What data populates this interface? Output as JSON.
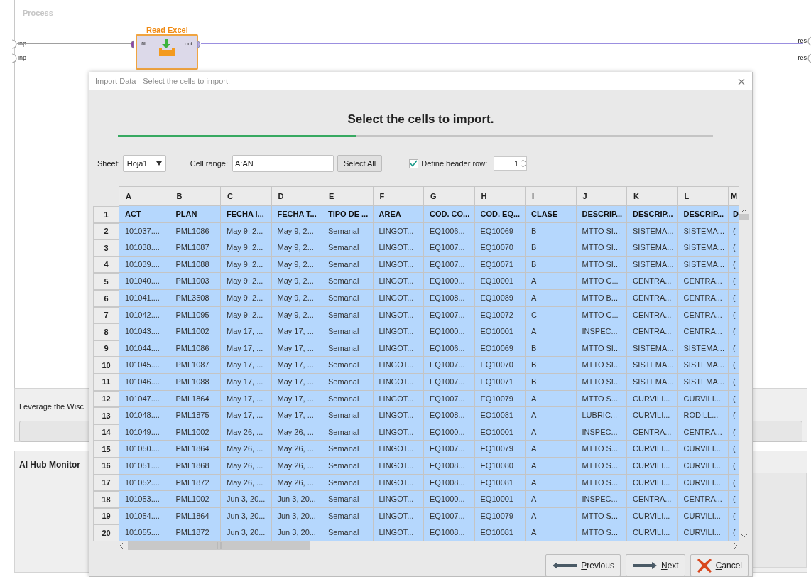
{
  "process": {
    "title": "Process",
    "input_ports": [
      "inp",
      "inp"
    ],
    "output_ports": [
      "res",
      "res"
    ],
    "operator": {
      "name": "Read Excel",
      "in_port": "fil",
      "out_port": "out"
    }
  },
  "panels": {
    "leverage_text": "Leverage the Wisc",
    "monitor_title": "AI Hub Monitor"
  },
  "dialog": {
    "title": "Import Data - Select the cells to import.",
    "heading": "Select the cells to import.",
    "progress": {
      "level": 0.4
    },
    "sheet": {
      "label": "Sheet:",
      "value": "Hoja1"
    },
    "cell_range": {
      "label": "Cell range:",
      "value": "A:AN"
    },
    "select_all": "Select All",
    "header_row": {
      "label": "Define header row:",
      "checked": true,
      "value": "1"
    },
    "table": {
      "columns": [
        "A",
        "B",
        "C",
        "D",
        "E",
        "F",
        "G",
        "H",
        "I",
        "J",
        "K",
        "L",
        "M"
      ],
      "rows": [
        {
          "number": "1",
          "header": true,
          "selected": true,
          "cells": [
            "ACT",
            "PLAN",
            "FECHA I...",
            "FECHA T...",
            "TIPO DE ...",
            "AREA",
            "COD. CO...",
            "COD. EQ...",
            "CLASE",
            "DESCRIP...",
            "DESCRIP...",
            "DESCRIP...",
            "D"
          ]
        },
        {
          "number": "2",
          "header": false,
          "selected": true,
          "cells": [
            "101037....",
            "PML1086",
            "May 9, 2...",
            "May 9, 2...",
            "Semanal",
            "LINGOT...",
            "EQ1006...",
            "EQ10069",
            "B",
            "MTTO SI...",
            "SISTEMA...",
            "SISTEMA...",
            "("
          ]
        },
        {
          "number": "3",
          "header": false,
          "selected": true,
          "cells": [
            "101038....",
            "PML1087",
            "May 9, 2...",
            "May 9, 2...",
            "Semanal",
            "LINGOT...",
            "EQ1007...",
            "EQ10070",
            "B",
            "MTTO SI...",
            "SISTEMA...",
            "SISTEMA...",
            "("
          ]
        },
        {
          "number": "4",
          "header": false,
          "selected": true,
          "cells": [
            "101039....",
            "PML1088",
            "May 9, 2...",
            "May 9, 2...",
            "Semanal",
            "LINGOT...",
            "EQ1007...",
            "EQ10071",
            "B",
            "MTTO SI...",
            "SISTEMA...",
            "SISTEMA...",
            "("
          ]
        },
        {
          "number": "5",
          "header": false,
          "selected": true,
          "cells": [
            "101040....",
            "PML1003",
            "May 9, 2...",
            "May 9, 2...",
            "Semanal",
            "LINGOT...",
            "EQ1000...",
            "EQ10001",
            "A",
            "MTTO C...",
            "CENTRA...",
            "CENTRA...",
            "("
          ]
        },
        {
          "number": "6",
          "header": false,
          "selected": true,
          "cells": [
            "101041....",
            "PML3508",
            "May 9, 2...",
            "May 9, 2...",
            "Semanal",
            "LINGOT...",
            "EQ1008...",
            "EQ10089",
            "A",
            "MTTO B...",
            "CENTRA...",
            "CENTRA...",
            "("
          ]
        },
        {
          "number": "7",
          "header": false,
          "selected": true,
          "cells": [
            "101042....",
            "PML1095",
            "May 9, 2...",
            "May 9, 2...",
            "Semanal",
            "LINGOT...",
            "EQ1007...",
            "EQ10072",
            "C",
            "MTTO C...",
            "CENTRA...",
            "CENTRA...",
            "("
          ]
        },
        {
          "number": "8",
          "header": false,
          "selected": true,
          "cells": [
            "101043....",
            "PML1002",
            "May 17, ...",
            "May 17, ...",
            "Semanal",
            "LINGOT...",
            "EQ1000...",
            "EQ10001",
            "A",
            "INSPEC...",
            "CENTRA...",
            "CENTRA...",
            "("
          ]
        },
        {
          "number": "9",
          "header": false,
          "selected": true,
          "cells": [
            "101044....",
            "PML1086",
            "May 17, ...",
            "May 17, ...",
            "Semanal",
            "LINGOT...",
            "EQ1006...",
            "EQ10069",
            "B",
            "MTTO SI...",
            "SISTEMA...",
            "SISTEMA...",
            "("
          ]
        },
        {
          "number": "10",
          "header": false,
          "selected": true,
          "cells": [
            "101045....",
            "PML1087",
            "May 17, ...",
            "May 17, ...",
            "Semanal",
            "LINGOT...",
            "EQ1007...",
            "EQ10070",
            "B",
            "MTTO SI...",
            "SISTEMA...",
            "SISTEMA...",
            "("
          ]
        },
        {
          "number": "11",
          "header": false,
          "selected": true,
          "cells": [
            "101046....",
            "PML1088",
            "May 17, ...",
            "May 17, ...",
            "Semanal",
            "LINGOT...",
            "EQ1007...",
            "EQ10071",
            "B",
            "MTTO SI...",
            "SISTEMA...",
            "SISTEMA...",
            "("
          ]
        },
        {
          "number": "12",
          "header": false,
          "selected": true,
          "cells": [
            "101047....",
            "PML1864",
            "May 17, ...",
            "May 17, ...",
            "Semanal",
            "LINGOT...",
            "EQ1007...",
            "EQ10079",
            "A",
            "MTTO S...",
            "CURVILI...",
            "CURVILI...",
            "("
          ]
        },
        {
          "number": "13",
          "header": false,
          "selected": true,
          "cells": [
            "101048....",
            "PML1875",
            "May 17, ...",
            "May 17, ...",
            "Semanal",
            "LINGOT...",
            "EQ1008...",
            "EQ10081",
            "A",
            "LUBRIC...",
            "CURVILI...",
            "RODILL...",
            "("
          ]
        },
        {
          "number": "14",
          "header": false,
          "selected": true,
          "cells": [
            "101049....",
            "PML1002",
            "May 26, ...",
            "May 26, ...",
            "Semanal",
            "LINGOT...",
            "EQ1000...",
            "EQ10001",
            "A",
            "INSPEC...",
            "CENTRA...",
            "CENTRA...",
            "("
          ]
        },
        {
          "number": "15",
          "header": false,
          "selected": true,
          "cells": [
            "101050....",
            "PML1864",
            "May 26, ...",
            "May 26, ...",
            "Semanal",
            "LINGOT...",
            "EQ1007...",
            "EQ10079",
            "A",
            "MTTO S...",
            "CURVILI...",
            "CURVILI...",
            "("
          ]
        },
        {
          "number": "16",
          "header": false,
          "selected": true,
          "cells": [
            "101051....",
            "PML1868",
            "May 26, ...",
            "May 26, ...",
            "Semanal",
            "LINGOT...",
            "EQ1008...",
            "EQ10080",
            "A",
            "MTTO S...",
            "CURVILI...",
            "CURVILI...",
            "("
          ]
        },
        {
          "number": "17",
          "header": false,
          "selected": true,
          "cells": [
            "101052....",
            "PML1872",
            "May 26, ...",
            "May 26, ...",
            "Semanal",
            "LINGOT...",
            "EQ1008...",
            "EQ10081",
            "A",
            "MTTO S...",
            "CURVILI...",
            "CURVILI...",
            "("
          ]
        },
        {
          "number": "18",
          "header": false,
          "selected": true,
          "cells": [
            "101053....",
            "PML1002",
            "Jun 3, 20...",
            "Jun 3, 20...",
            "Semanal",
            "LINGOT...",
            "EQ1000...",
            "EQ10001",
            "A",
            "INSPEC...",
            "CENTRA...",
            "CENTRA...",
            "("
          ]
        },
        {
          "number": "19",
          "header": false,
          "selected": true,
          "cells": [
            "101054....",
            "PML1864",
            "Jun 3, 20...",
            "Jun 3, 20...",
            "Semanal",
            "LINGOT...",
            "EQ1007...",
            "EQ10079",
            "A",
            "MTTO S...",
            "CURVILI...",
            "CURVILI...",
            "("
          ]
        },
        {
          "number": "20",
          "header": false,
          "selected": true,
          "cells": [
            "101055....",
            "PML1872",
            "Jun 3, 20...",
            "Jun 3, 20...",
            "Semanal",
            "LINGOT...",
            "EQ1008...",
            "EQ10081",
            "A",
            "MTTO S...",
            "CURVILI...",
            "CURVILI...",
            "("
          ]
        }
      ]
    },
    "buttons": [
      {
        "kind": "previous",
        "label": "Previous"
      },
      {
        "kind": "next",
        "label": "Next"
      },
      {
        "kind": "cancel",
        "label": "Cancel"
      }
    ]
  }
}
